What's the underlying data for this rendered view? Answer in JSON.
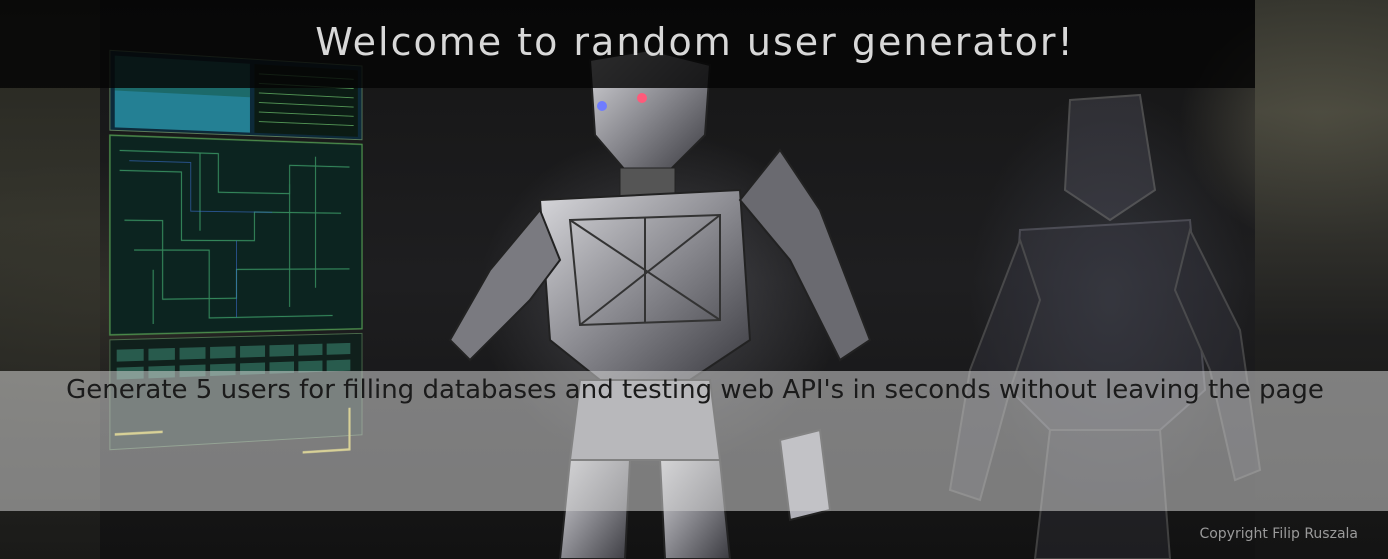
{
  "header": {
    "title": "Welcome to random user generator!"
  },
  "main": {
    "description": "Generate 5 users for filling databases and testing web API's in seconds without leaving the page"
  },
  "footer": {
    "copyright": "Copyright Filip Ruszala"
  },
  "background": {
    "image": "robot-hologram-illustration"
  },
  "colors": {
    "header_bar": "#050505",
    "header_text": "#d8d8d8",
    "mid_bar": "#d2d2d2",
    "mid_text": "#1b1b1b",
    "footer_text": "#9a9a9a"
  }
}
